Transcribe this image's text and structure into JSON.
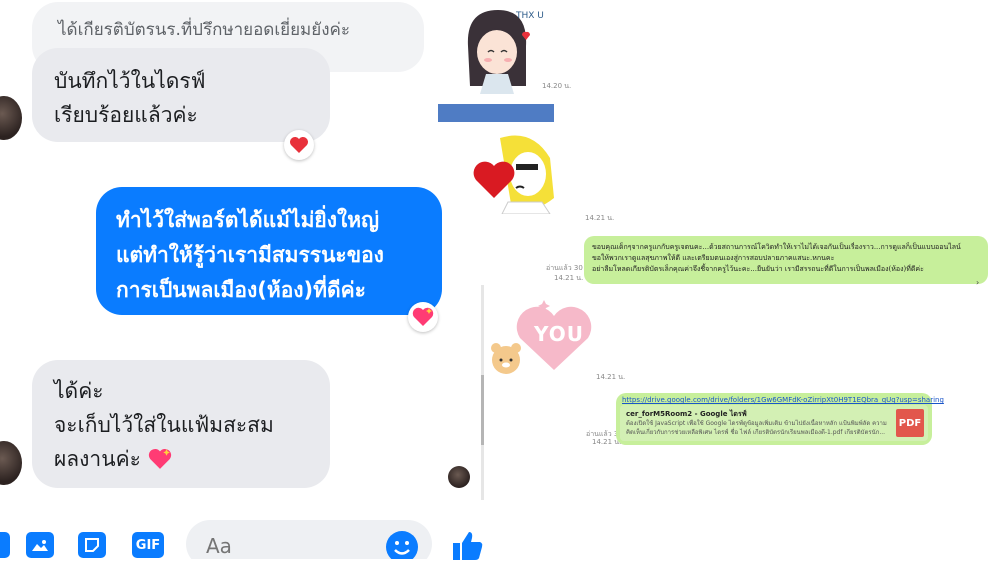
{
  "messenger": {
    "messages": [
      {
        "lines": [
          "ได้เกียรติบัตรนร.ที่ปรึกษายอดเยี่ยมยังค่ะ"
        ]
      },
      {
        "lines": [
          "บันทึกไว้ในไดรฟ์",
          "เรียบร้อยแล้วค่ะ"
        ],
        "reaction": "heart"
      },
      {
        "lines": [
          "ทำไว้ใส่พอร์ตได้แม้ไม่ยิ่งใหญ่",
          "แต่ทำให้รู้ว่าเรามีสมรรนะของ",
          "การเป็นพลเมือง(ห้อง)ที่ดีค่ะ"
        ],
        "reaction": "sparkle-heart"
      },
      {
        "lines": [
          "ได้ค่ะ",
          "จะเก็บไว้ใส่ในแฟ้มสะสม",
          "ผลงานค่ะ"
        ],
        "reaction": "sparkle-heart"
      }
    ],
    "composer": {
      "placeholder": "Aa"
    },
    "toolbar": {
      "gif_label": "GIF"
    }
  },
  "line_chat": {
    "sticker1": {
      "text": "THX U",
      "time": "14.20 น."
    },
    "sticker2": {
      "time": "14.21 น."
    },
    "message": {
      "read": "อ่านแล้ว 30",
      "time": "14.21 น.",
      "lines": [
        "ขอบคุณเด็กๆจากครูแกกับครูเจตนคะ...ด้วยสถานการณ์โควิดทำให้เราไม่ได้เจอกันเป็นเรื่องราว...การดูแลก็เป็นแบบออนไลน์",
        "ขอให้พวกเราดูแลสุขภาพให้ดี และเตรียมตนเองสู่การสอบปลายภาคแสนะ.หกนคะ",
        "อย่าลืมโหลดเกียรติบัตรเล็กคุณค่าจึงชี้จากครูไว้นะคะ...ยืนยันว่า เรามีสรรถนะที่ดีในการเป็นพลเมือง(ห้อง)ที่ดีค่ะ"
      ]
    },
    "sticker3": {
      "text": "YOU",
      "time": "14.21 น."
    },
    "link_message": {
      "read": "อ่านแล้ว 30",
      "time": "14.21 น.",
      "url": "https://drive.google.com/drive/folders/1Gw6GMFdK-oZirripXt0H9T1EQbra_qUq?usp=sharing",
      "title": "cer_forM5Room2 - Google ไดรฟ์",
      "desc": "ต้องเปิดใช้ JavaScript เพื่อใช้ Google ไดรฟ์ดูข้อมูลเพิ่มเติม ข้ามไปยังเนื้อหาหลัก แป้นพิมพ์ลัด ความคิดเห็นเกี่ยวกับการช่วยเหลือพิเศษ ไดรฟ์ ชื่อ ไฟล์ เกียรติบัตรนักเรียนพลเมืองดี-1.pdf เกียรติบัตรนัก...",
      "badge": "PDF"
    }
  },
  "colors": {
    "messenger_blue": "#0a7cff",
    "line_green": "#c7ef9b",
    "heart_red": "#e8313b",
    "redacted_bar": "#4f7cc4"
  }
}
